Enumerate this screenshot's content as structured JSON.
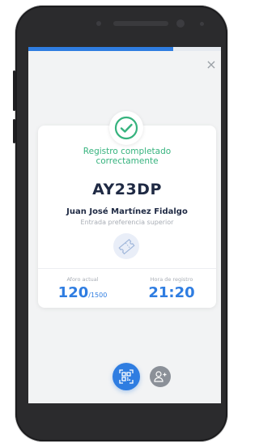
{
  "progress": {
    "fraction": 0.75
  },
  "close": {
    "glyph": "×"
  },
  "result": {
    "message": "Registro completado correctamente",
    "icon": "checkmark-circle-icon"
  },
  "booking": {
    "code": "AY23DP",
    "name": "Juan José Martínez Fidalgo",
    "ticket_type": "Entrada preferencia superior",
    "ticket_icon": "ticket-icon"
  },
  "stats": {
    "capacity_label": "Aforo actual",
    "capacity_value": "120",
    "capacity_max": "/1500",
    "time_label": "Hora de registro",
    "time_value": "21:20"
  },
  "actions": {
    "scan_icon": "qr-scan-icon",
    "add_user_icon": "add-user-icon"
  },
  "colors": {
    "accent": "#2f7de1",
    "success": "#36b37e",
    "text_dark": "#1f2a44",
    "muted": "#a8adb5"
  }
}
